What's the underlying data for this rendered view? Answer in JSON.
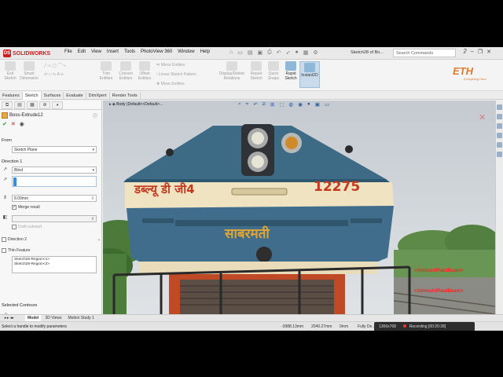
{
  "app": {
    "name": "SOLIDWORKS",
    "doc_title": "Sketch28 of Bo...",
    "search_placeholder": "Search Commands"
  },
  "menu": [
    "File",
    "Edit",
    "View",
    "Insert",
    "Tools",
    "PhotoView 360",
    "Window",
    "Help"
  ],
  "ribbon": {
    "exit_sketch": "Exit Sketch",
    "smart_dimension": "Smart Dimension",
    "trim_entities": "Trim Entities",
    "convert_entities": "Convert Entities",
    "offset_entities": "Offset Entities",
    "mirror_entities": "Mirror Entities",
    "linear_sketch_pattern": "Linear Sketch Pattern",
    "move_entities": "Move Entities",
    "display_delete_relations": "Display/Delete Relations",
    "repair_sketch": "Repair Sketch",
    "quick_snaps": "Quick Snaps",
    "rapid_sketch": "Rapid Sketch",
    "instant2d": "Instant2D"
  },
  "brand": {
    "logo": "ETH",
    "tagline": "Everything Here"
  },
  "tabs": [
    "Features",
    "Sketch",
    "Surfaces",
    "Evaluate",
    "DimXpert",
    "Render Tools"
  ],
  "active_tab": "Sketch",
  "property_manager": {
    "title": "Boss-Extrude12",
    "from_label": "From",
    "from_value": "Sketch Plane",
    "direction1_label": "Direction 1",
    "end_condition": "Blind",
    "depth": "8.00mm",
    "merge_result": "Merge result",
    "draft_outward": "Draft outward",
    "direction2_label": "Direction 2",
    "thin_feature_label": "Thin Feature",
    "selected_contours_label": "Selected Contours",
    "contours": [
      "Sketch28-Region<1>",
      "Sketch28-Region<2>"
    ]
  },
  "viewport": {
    "breadcrumb": "Body  (Default<<Default>..."
  },
  "photo": {
    "hindi_code": "डब्ल्यू डी जी4",
    "number": "12275",
    "name": "साबरमती",
    "watermark1": "<AtmosUIPlastBeam>",
    "watermark2": "<AtmosAIPlastBeam>"
  },
  "bottom_tabs": [
    "Model",
    "3D Views",
    "Motion Study 1"
  ],
  "active_bottom_tab": "Model",
  "status": {
    "message": "Select a handle to modify parameters",
    "x": "-3988.13mm",
    "y": "2040.27mm",
    "z": "0mm",
    "mode": "Fully De...",
    "recording": "Recording [00:20:28]",
    "resolution": "1366x768"
  }
}
